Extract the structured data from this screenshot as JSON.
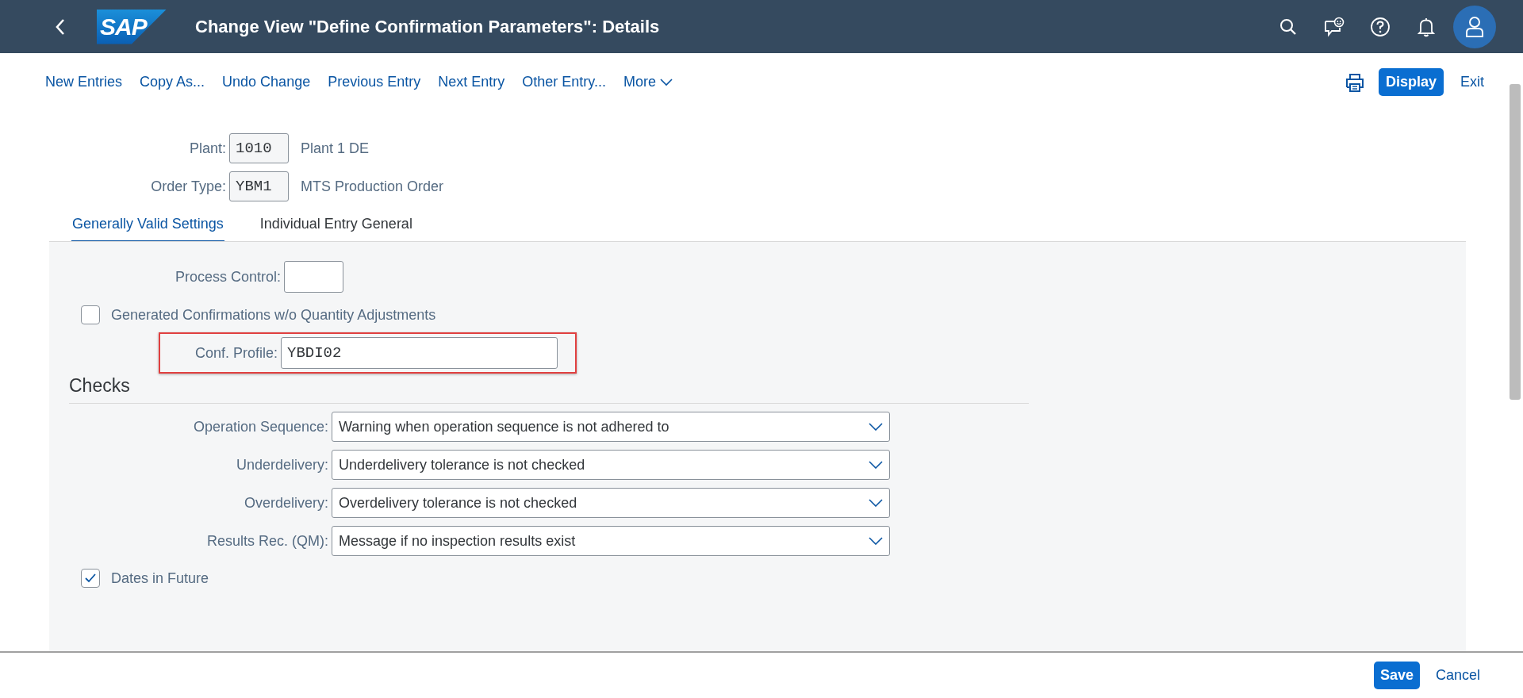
{
  "header": {
    "logo": "SAP",
    "title": "Change View \"Define Confirmation Parameters\": Details"
  },
  "toolbar": {
    "actions": [
      "New Entries",
      "Copy As...",
      "Undo Change",
      "Previous Entry",
      "Next Entry",
      "Other Entry..."
    ],
    "more": "More",
    "primary": "Display",
    "exit": "Exit"
  },
  "key_fields": [
    {
      "label": "Plant:",
      "value": "1010",
      "description": "Plant 1 DE"
    },
    {
      "label": "Order Type:",
      "value": "YBM1",
      "description": "MTS Production Order"
    }
  ],
  "tabs": [
    {
      "label": "Generally Valid Settings",
      "selected": true
    },
    {
      "label": "Individual Entry General",
      "selected": false
    }
  ],
  "settings": [
    {
      "kind": "input",
      "label": "Process Control:",
      "highlighted": false
    },
    {
      "kind": "checkbox",
      "label": "Generated Confirmations w/o Quantity Adjustments",
      "checked": false
    },
    {
      "kind": "input",
      "label": "Conf. Profile:",
      "value": "YBDI02",
      "highlighted": true
    }
  ],
  "checks": {
    "title": "Checks",
    "selects": [
      {
        "label": "Operation Sequence:",
        "value": "Warning when operation sequence is not adhered to"
      },
      {
        "label": "Underdelivery:",
        "value": "Underdelivery tolerance is not checked"
      },
      {
        "label": "Overdelivery:",
        "value": "Overdelivery tolerance is not checked"
      },
      {
        "label": "Results Rec. (QM):",
        "value": "Message if no inspection results exist"
      }
    ],
    "options": [
      {
        "label": "Dates in Future",
        "checked": true
      }
    ]
  },
  "footer": {
    "save": "Save",
    "cancel": "Cancel"
  }
}
